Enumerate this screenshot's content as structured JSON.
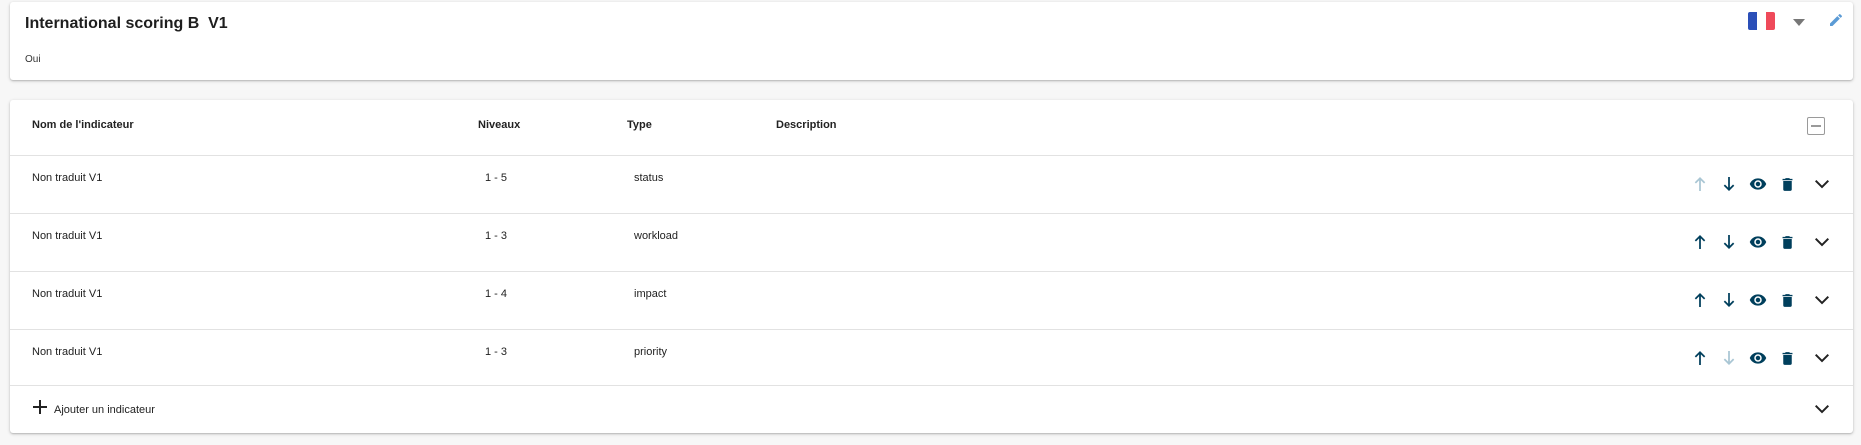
{
  "header": {
    "title": "International scoring B  V1",
    "subtitle": "Oui",
    "language_flag": "france-flag-icon",
    "caret_icon": "caret-down-icon",
    "edit_icon": "pencil-icon",
    "colors": {
      "edit": "#5b9bd5",
      "caret": "#777777"
    }
  },
  "table": {
    "columns": {
      "name": "Nom de l'indicateur",
      "levels": "Niveaux",
      "type": "Type",
      "description": "Description"
    },
    "rows": [
      {
        "name": "Non traduit V1",
        "levels": "1 - 5",
        "type": "status",
        "description": "",
        "up_enabled": false,
        "down_enabled": true
      },
      {
        "name": "Non traduit V1",
        "levels": "1 - 3",
        "type": "workload",
        "description": "",
        "up_enabled": true,
        "down_enabled": true
      },
      {
        "name": "Non traduit V1",
        "levels": "1 - 4",
        "type": "impact",
        "description": "",
        "up_enabled": true,
        "down_enabled": true
      },
      {
        "name": "Non traduit V1",
        "levels": "1 - 3",
        "type": "priority",
        "description": "",
        "up_enabled": true,
        "down_enabled": false
      }
    ],
    "add_label": "Ajouter un indicateur",
    "icons": [
      "arrow-up-icon",
      "arrow-down-icon",
      "eye-icon",
      "trash-icon",
      "chevron-down-icon",
      "collapse-all-icon",
      "plus-icon"
    ],
    "colors": {
      "action": "#003f5c",
      "action_disabled": "#a9c6d4"
    }
  }
}
